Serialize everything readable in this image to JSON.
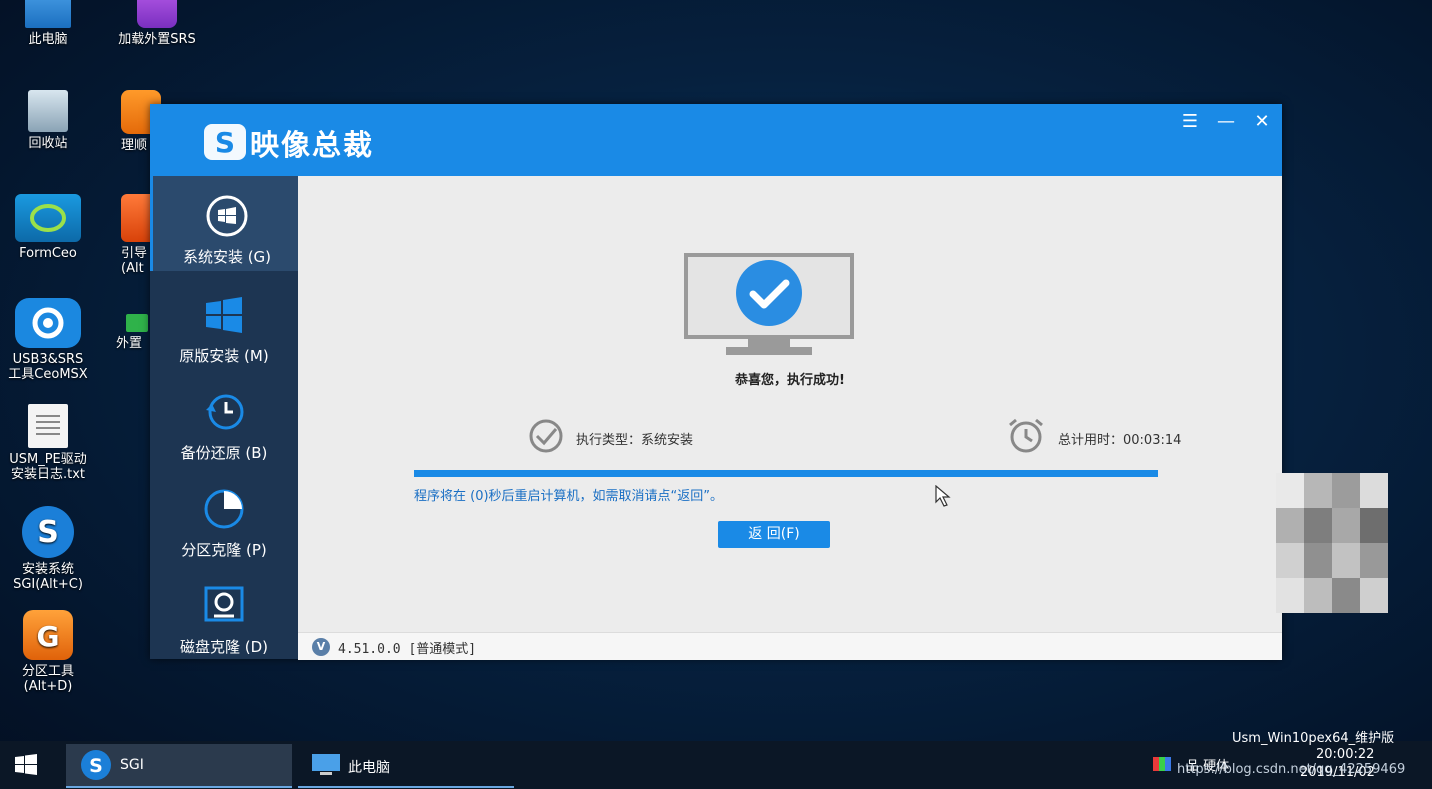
{
  "desktop": {
    "icons": [
      {
        "label": "此电脑"
      },
      {
        "label": "加载外置SRS"
      },
      {
        "label": "回收站"
      },
      {
        "label": "理顺"
      },
      {
        "label": "FormCeo"
      },
      {
        "label": "引导\n(Alt"
      },
      {
        "label": "USB3&SRS\n工具CeoMSX"
      },
      {
        "label": "外置"
      },
      {
        "label": "USM_PE驱动\n安装日志.txt"
      },
      {
        "label": "安装系统\nSGI(Alt+C)"
      },
      {
        "label": "分区工具\n(Alt+D)"
      }
    ]
  },
  "window": {
    "title": "映像总裁",
    "controls": {
      "menu": "☰",
      "minimize": "—",
      "close": "✕"
    },
    "sidebar": [
      {
        "label": "系统安装 (G)",
        "icon": "windows-circle-icon",
        "active": true
      },
      {
        "label": "原版安装 (M)",
        "icon": "windows-logo-icon",
        "active": false
      },
      {
        "label": "备份还原 (B)",
        "icon": "clock-restore-icon",
        "active": false
      },
      {
        "label": "分区克隆 (P)",
        "icon": "pie-chart-icon",
        "active": false
      },
      {
        "label": "磁盘克隆 (D)",
        "icon": "disk-clone-icon",
        "active": false
      }
    ],
    "content": {
      "success_message": "恭喜您，执行成功!",
      "exec_type": "执行类型：系统安装",
      "total_time": "总计用时：00:03:14",
      "progress": 1.0,
      "notice": "程序将在 (0)秒后重启计算机，如需取消请点“返回”。",
      "back_button": "返 回(F)"
    },
    "footer": {
      "version_badge": "V",
      "version": "4.51.0.0 [普通模式]"
    }
  },
  "taskbar": {
    "tasks": [
      {
        "label": "SGI",
        "active": true
      },
      {
        "label": "此电脑",
        "active": false
      }
    ],
    "tray": {
      "os_label": "Usm_Win10pex64_维护版",
      "time": "20:00:22",
      "date": "2019/11/02",
      "tray_icon_text": "品 硬体"
    }
  },
  "watermark": "https://blog.csdn.net/qq_42259469",
  "colors": {
    "accent": "#1a8ae6",
    "sidebar": "#1d3552",
    "desktop": "#06213f"
  }
}
